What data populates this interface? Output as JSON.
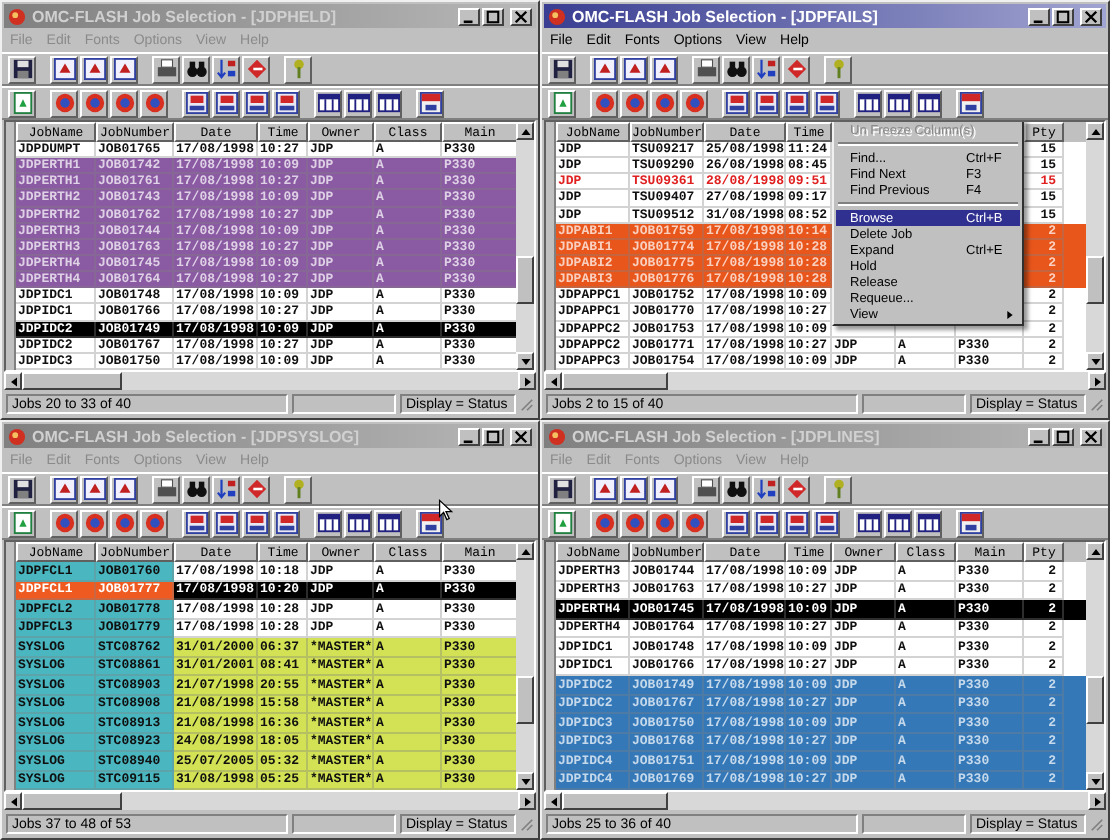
{
  "windows": [
    {
      "title": "OMC-FLASH Job Selection - [JDPHELD]",
      "active": false,
      "menu": [
        "File",
        "Edit",
        "Fonts",
        "Options",
        "View",
        "Help"
      ],
      "columns": [
        "JobName",
        "JobNumber",
        "Date",
        "Time",
        "Owner",
        "Class",
        "Main"
      ],
      "rows": [
        {
          "cells": [
            "JDPDUMPT",
            "JOB01765",
            "17/08/1998",
            "10:27",
            "JDP",
            "A",
            "P330"
          ],
          "selected": false,
          "color": "#ffffff"
        },
        {
          "cells": [
            "JDPERTH1",
            "JOB01742",
            "17/08/1998",
            "10:09",
            "JDP",
            "A",
            "P330"
          ],
          "selected": false,
          "color": "#8a5aa2"
        },
        {
          "cells": [
            "JDPERTH1",
            "JOB01761",
            "17/08/1998",
            "10:27",
            "JDP",
            "A",
            "P330"
          ],
          "selected": false,
          "color": "#8a5aa2"
        },
        {
          "cells": [
            "JDPERTH2",
            "JOB01743",
            "17/08/1998",
            "10:09",
            "JDP",
            "A",
            "P330"
          ],
          "selected": false,
          "color": "#8a5aa2"
        },
        {
          "cells": [
            "JDPERTH2",
            "JOB01762",
            "17/08/1998",
            "10:27",
            "JDP",
            "A",
            "P330"
          ],
          "selected": false,
          "color": "#8a5aa2"
        },
        {
          "cells": [
            "JDPERTH3",
            "JOB01744",
            "17/08/1998",
            "10:09",
            "JDP",
            "A",
            "P330"
          ],
          "selected": false,
          "color": "#8a5aa2"
        },
        {
          "cells": [
            "JDPERTH3",
            "JOB01763",
            "17/08/1998",
            "10:27",
            "JDP",
            "A",
            "P330"
          ],
          "selected": false,
          "color": "#8a5aa2"
        },
        {
          "cells": [
            "JDPERTH4",
            "JOB01745",
            "17/08/1998",
            "10:09",
            "JDP",
            "A",
            "P330"
          ],
          "selected": false,
          "color": "#8a5aa2"
        },
        {
          "cells": [
            "JDPERTH4",
            "JOB01764",
            "17/08/1998",
            "10:27",
            "JDP",
            "A",
            "P330"
          ],
          "selected": false,
          "color": "#8a5aa2"
        },
        {
          "cells": [
            "JDPIDC1",
            "JOB01748",
            "17/08/1998",
            "10:09",
            "JDP",
            "A",
            "P330"
          ],
          "selected": false,
          "color": "#ffffff"
        },
        {
          "cells": [
            "JDPIDC1",
            "JOB01766",
            "17/08/1998",
            "10:27",
            "JDP",
            "A",
            "P330"
          ],
          "selected": false,
          "color": "#ffffff"
        },
        {
          "cells": [
            "JDPIDC2",
            "JOB01749",
            "17/08/1998",
            "10:09",
            "JDP",
            "A",
            "P330"
          ],
          "selected": true
        },
        {
          "cells": [
            "JDPIDC2",
            "JOB01767",
            "17/08/1998",
            "10:27",
            "JDP",
            "A",
            "P330"
          ],
          "selected": false,
          "color": "#ffffff"
        },
        {
          "cells": [
            "JDPIDC3",
            "JOB01750",
            "17/08/1998",
            "10:09",
            "JDP",
            "A",
            "P330"
          ],
          "selected": false,
          "color": "#ffffff"
        }
      ],
      "status": {
        "jobs": "Jobs 20 to 33 of 40",
        "display": "Display = Status"
      }
    },
    {
      "title": "OMC-FLASH Job Selection - [JDPFAILS]",
      "active": true,
      "menu": [
        "File",
        "Edit",
        "Fonts",
        "Options",
        "View",
        "Help"
      ],
      "columns": [
        "JobName",
        "JobNumber",
        "Date",
        "Time",
        null,
        null,
        null,
        "Pty"
      ],
      "rows": [
        {
          "kind": "normal",
          "cells": [
            "JDP",
            "TSU09217",
            "25/08/1998",
            "11:24",
            null,
            null,
            null,
            "15"
          ],
          "selected": false,
          "color": "#ffffff"
        },
        {
          "kind": "normal",
          "cells": [
            "JDP",
            "TSU09290",
            "26/08/1998",
            "08:45",
            null,
            null,
            null,
            "15"
          ],
          "selected": false,
          "color": "#ffffff"
        },
        {
          "kind": "alert",
          "cells": [
            "JDP",
            "TSU09361",
            "28/08/1998",
            "09:51",
            null,
            null,
            null,
            "15"
          ],
          "selected": false,
          "color": "#ffffff"
        },
        {
          "kind": "normal",
          "cells": [
            "JDP",
            "TSU09407",
            "27/08/1998",
            "09:17",
            null,
            null,
            null,
            "15"
          ],
          "selected": false,
          "color": "#ffffff"
        },
        {
          "kind": "normal",
          "cells": [
            "JDP",
            "TSU09512",
            "31/08/1998",
            "08:52",
            null,
            null,
            null,
            "15"
          ],
          "selected": false,
          "color": "#ffffff"
        },
        {
          "kind": "normal",
          "cells": [
            "JDPABI1",
            "JOB01759",
            "17/08/1998",
            "10:14",
            null,
            null,
            null,
            "2"
          ],
          "selected": false,
          "color": "#e8561c"
        },
        {
          "kind": "normal",
          "cells": [
            "JDPABI1",
            "JOB01774",
            "17/08/1998",
            "10:28",
            null,
            null,
            null,
            "2"
          ],
          "selected": false,
          "color": "#e8561c"
        },
        {
          "kind": "normal",
          "cells": [
            "JDPABI2",
            "JOB01775",
            "17/08/1998",
            "10:28",
            null,
            null,
            null,
            "2"
          ],
          "selected": false,
          "color": "#e8561c"
        },
        {
          "kind": "normal",
          "cells": [
            "JDPABI3",
            "JOB01776",
            "17/08/1998",
            "10:28",
            null,
            null,
            null,
            "2"
          ],
          "selected": false,
          "color": "#e8561c"
        },
        {
          "kind": "normal",
          "cells": [
            "JDPAPPC1",
            "JOB01752",
            "17/08/1998",
            "10:09",
            null,
            null,
            null,
            "2"
          ],
          "selected": false,
          "color": "#ffffff"
        },
        {
          "kind": "normal",
          "cells": [
            "JDPAPPC1",
            "JOB01770",
            "17/08/1998",
            "10:27",
            null,
            null,
            null,
            "2"
          ],
          "selected": false,
          "color": "#ffffff"
        },
        {
          "kind": "normal",
          "cells": [
            "JDPAPPC2",
            "JOB01753",
            "17/08/1998",
            "10:09",
            null,
            null,
            null,
            "2"
          ],
          "selected": false,
          "color": "#ffffff"
        },
        {
          "kind": "normal",
          "cells": [
            "JDPAPPC2",
            "JOB01771",
            "17/08/1998",
            "10:27",
            "JDP",
            "A",
            "P330",
            "2"
          ],
          "selected": false,
          "color": "#ffffff"
        },
        {
          "kind": "normal",
          "cells": [
            "JDPAPPC3",
            "JOB01754",
            "17/08/1998",
            "10:09",
            "JDP",
            "A",
            "P330",
            "2"
          ],
          "selected": false,
          "color": "#ffffff"
        }
      ],
      "context_menu": {
        "items": [
          {
            "kind": "item",
            "label": "Un Freeze Column(s)",
            "disabled": true,
            "selected": false
          },
          {
            "kind": "separator"
          },
          {
            "kind": "item",
            "label": "Find...",
            "shortcut": "Ctrl+F",
            "disabled": false,
            "selected": false
          },
          {
            "kind": "item",
            "label": "Find Next",
            "shortcut": "F3",
            "disabled": false,
            "selected": false
          },
          {
            "kind": "item",
            "label": "Find Previous",
            "shortcut": "F4",
            "disabled": false,
            "selected": false
          },
          {
            "kind": "separator"
          },
          {
            "kind": "item",
            "label": "Browse",
            "shortcut": "Ctrl+B",
            "disabled": false,
            "selected": true
          },
          {
            "kind": "item",
            "label": "Delete Job",
            "disabled": false,
            "selected": false
          },
          {
            "kind": "item",
            "label": "Expand",
            "shortcut": "Ctrl+E",
            "disabled": false,
            "selected": false
          },
          {
            "kind": "item",
            "label": "Hold",
            "disabled": false,
            "selected": false
          },
          {
            "kind": "item",
            "label": "Release",
            "disabled": false,
            "selected": false
          },
          {
            "kind": "item",
            "label": "Requeue...",
            "disabled": false,
            "selected": false
          },
          {
            "kind": "submenu",
            "label": "View",
            "disabled": false,
            "selected": false
          }
        ]
      },
      "status": {
        "jobs": "Jobs 2 to 15 of 40",
        "display": "Display = Status"
      }
    },
    {
      "title": "OMC-FLASH Job Selection - [JDPSYSLOG]",
      "active": false,
      "menu": [
        "File",
        "Edit",
        "Fonts",
        "Options",
        "View",
        "Help"
      ],
      "columns": [
        "JobName",
        "JobNumber",
        "Date",
        "Time",
        "Owner",
        "Class",
        "Main"
      ],
      "rows": [
        {
          "cells": [
            "JDPFCL1",
            "JOB01760",
            "17/08/1998",
            "10:18",
            "JDP",
            "A",
            "P330"
          ],
          "selected": false,
          "key_columns": {
            "color": "#4ab6c0"
          },
          "color": "#ffffff"
        },
        {
          "cells": [
            "JDPFCL1",
            "JOB01777",
            "17/08/1998",
            "10:20",
            "JDP",
            "A",
            "P330"
          ],
          "selected": true,
          "key_columns": {
            "color": "#ee5a20"
          }
        },
        {
          "cells": [
            "JDPFCL2",
            "JOB01778",
            "17/08/1998",
            "10:28",
            "JDP",
            "A",
            "P330"
          ],
          "selected": false,
          "key_columns": {
            "color": "#4ab6c0"
          },
          "color": "#ffffff"
        },
        {
          "cells": [
            "JDPFCL3",
            "JOB01779",
            "17/08/1998",
            "10:28",
            "JDP",
            "A",
            "P330"
          ],
          "selected": false,
          "key_columns": {
            "color": "#4ab6c0"
          },
          "color": "#ffffff"
        },
        {
          "cells": [
            "SYSLOG",
            "STC08762",
            "31/01/2000",
            "06:37",
            "*MASTER*",
            "A",
            "P330"
          ],
          "selected": false,
          "key_columns": {
            "color": "#4ab6c0"
          },
          "color": "#d2e254"
        },
        {
          "cells": [
            "SYSLOG",
            "STC08861",
            "31/01/2001",
            "08:41",
            "*MASTER*",
            "A",
            "P330"
          ],
          "selected": false,
          "key_columns": {
            "color": "#4ab6c0"
          },
          "color": "#d2e254"
        },
        {
          "cells": [
            "SYSLOG",
            "STC08903",
            "21/07/1998",
            "20:55",
            "*MASTER*",
            "A",
            "P330"
          ],
          "selected": false,
          "key_columns": {
            "color": "#4ab6c0"
          },
          "color": "#d2e254"
        },
        {
          "cells": [
            "SYSLOG",
            "STC08908",
            "21/08/1998",
            "15:58",
            "*MASTER*",
            "A",
            "P330"
          ],
          "selected": false,
          "key_columns": {
            "color": "#4ab6c0"
          },
          "color": "#d2e254"
        },
        {
          "cells": [
            "SYSLOG",
            "STC08913",
            "21/08/1998",
            "16:36",
            "*MASTER*",
            "A",
            "P330"
          ],
          "selected": false,
          "key_columns": {
            "color": "#4ab6c0"
          },
          "color": "#d2e254"
        },
        {
          "cells": [
            "SYSLOG",
            "STC08923",
            "24/08/1998",
            "18:05",
            "*MASTER*",
            "A",
            "P330"
          ],
          "selected": false,
          "key_columns": {
            "color": "#4ab6c0"
          },
          "color": "#d2e254"
        },
        {
          "cells": [
            "SYSLOG",
            "STC08940",
            "25/07/2005",
            "05:32",
            "*MASTER*",
            "A",
            "P330"
          ],
          "selected": false,
          "key_columns": {
            "color": "#4ab6c0"
          },
          "color": "#d2e254"
        },
        {
          "cells": [
            "SYSLOG",
            "STC09115",
            "31/08/1998",
            "05:25",
            "*MASTER*",
            "A",
            "P330"
          ],
          "selected": false,
          "key_columns": {
            "color": "#4ab6c0"
          },
          "color": "#d2e254"
        }
      ],
      "status": {
        "jobs": "Jobs 37 to 48 of 53",
        "display": "Display = Status"
      }
    },
    {
      "title": "OMC-FLASH Job Selection - [JDPLINES]",
      "active": false,
      "menu": [
        "File",
        "Edit",
        "Fonts",
        "Options",
        "View",
        "Help"
      ],
      "columns": [
        "JobName",
        "JobNumber",
        "Date",
        "Time",
        "Owner",
        "Class",
        "Main",
        "Pty"
      ],
      "rows": [
        {
          "cells": [
            "JDPERTH3",
            "JOB01744",
            "17/08/1998",
            "10:09",
            "JDP",
            "A",
            "P330",
            "2"
          ],
          "selected": false,
          "color": "#ffffff"
        },
        {
          "cells": [
            "JDPERTH3",
            "JOB01763",
            "17/08/1998",
            "10:27",
            "JDP",
            "A",
            "P330",
            "2"
          ],
          "selected": false,
          "color": "#ffffff"
        },
        {
          "cells": [
            "JDPERTH4",
            "JOB01745",
            "17/08/1998",
            "10:09",
            "JDP",
            "A",
            "P330",
            "2"
          ],
          "selected": true
        },
        {
          "cells": [
            "JDPERTH4",
            "JOB01764",
            "17/08/1998",
            "10:27",
            "JDP",
            "A",
            "P330",
            "2"
          ],
          "selected": false,
          "color": "#ffffff"
        },
        {
          "cells": [
            "JDPIDC1",
            "JOB01748",
            "17/08/1998",
            "10:09",
            "JDP",
            "A",
            "P330",
            "2"
          ],
          "selected": false,
          "color": "#ffffff"
        },
        {
          "cells": [
            "JDPIDC1",
            "JOB01766",
            "17/08/1998",
            "10:27",
            "JDP",
            "A",
            "P330",
            "2"
          ],
          "selected": false,
          "color": "#ffffff"
        },
        {
          "cells": [
            "JDPIDC2",
            "JOB01749",
            "17/08/1998",
            "10:09",
            "JDP",
            "A",
            "P330",
            "2"
          ],
          "selected": false,
          "color": "#3478b8"
        },
        {
          "cells": [
            "JDPIDC2",
            "JOB01767",
            "17/08/1998",
            "10:27",
            "JDP",
            "A",
            "P330",
            "2"
          ],
          "selected": false,
          "color": "#3478b8"
        },
        {
          "cells": [
            "JDPIDC3",
            "JOB01750",
            "17/08/1998",
            "10:09",
            "JDP",
            "A",
            "P330",
            "2"
          ],
          "selected": false,
          "color": "#3478b8"
        },
        {
          "cells": [
            "JDPIDC3",
            "JOB01768",
            "17/08/1998",
            "10:27",
            "JDP",
            "A",
            "P330",
            "2"
          ],
          "selected": false,
          "color": "#3478b8"
        },
        {
          "cells": [
            "JDPIDC4",
            "JOB01751",
            "17/08/1998",
            "10:09",
            "JDP",
            "A",
            "P330",
            "2"
          ],
          "selected": false,
          "color": "#3478b8"
        },
        {
          "cells": [
            "JDPIDC4",
            "JOB01769",
            "17/08/1998",
            "10:27",
            "JDP",
            "A",
            "P330",
            "2"
          ],
          "selected": false,
          "color": "#3478b8"
        }
      ],
      "status": {
        "jobs": "Jobs 25 to 36 of 40",
        "display": "Display = Status"
      }
    }
  ]
}
